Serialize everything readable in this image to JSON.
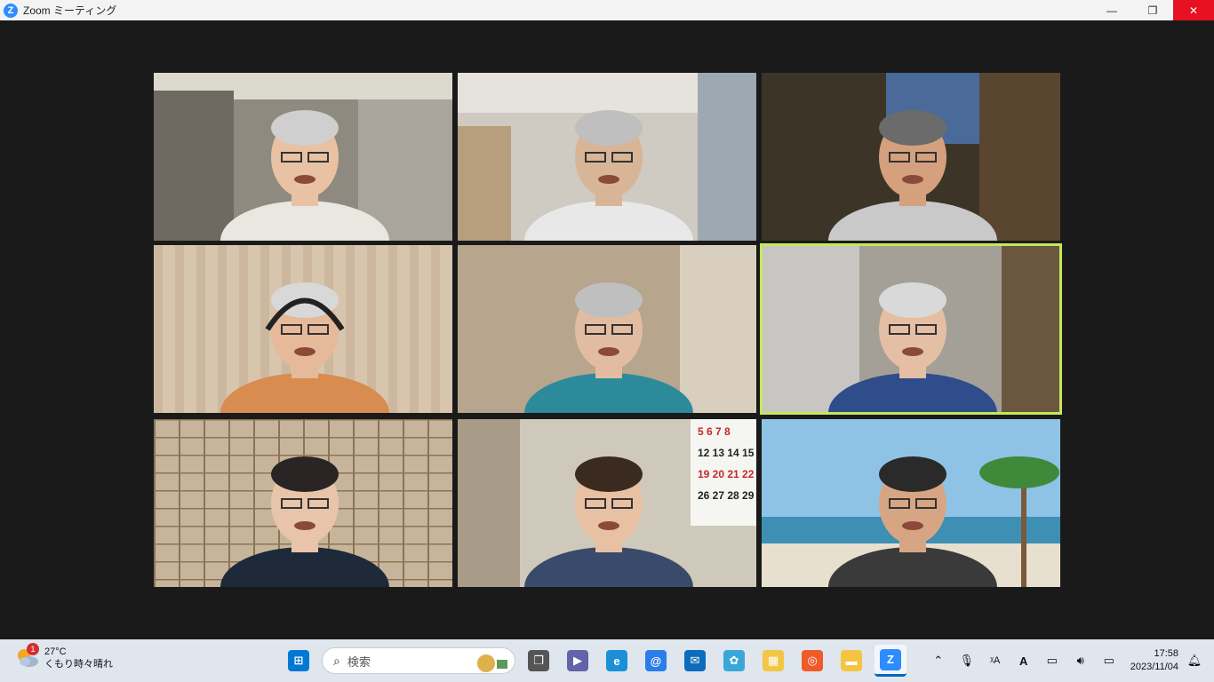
{
  "window": {
    "title": "Zoom ミーティング",
    "app_icon": "zoom-icon",
    "controls": [
      "minimize-icon",
      "restore-icon",
      "close-icon"
    ]
  },
  "meeting": {
    "participants": [
      {
        "id": 1,
        "bg": "#8f8a80",
        "shirt": "#e8e8e0",
        "skin": "#e8c2a3",
        "hair": "#cfcfcf",
        "scene": "outdoor-canal"
      },
      {
        "id": 2,
        "bg": "#cfcac2",
        "shirt": "#e8e8e8",
        "skin": "#d9b597",
        "hair": "#bfbfbf",
        "scene": "room-curtain"
      },
      {
        "id": 3,
        "bg": "#3d3428",
        "shirt": "#c9c9c9",
        "skin": "#d4a07e",
        "hair": "#6b6b6b",
        "scene": "study-bookshelf"
      },
      {
        "id": 4,
        "bg": "#d8c5ae",
        "shirt": "#d98c4f",
        "skin": "#e6b99a",
        "hair": "#d8d8d8",
        "scene": "curtain-headphones"
      },
      {
        "id": 5,
        "bg": "#b7a58e",
        "shirt": "#2d8a9b",
        "skin": "#e2bca1",
        "hair": "#bfbfbf",
        "scene": "blurred-room"
      },
      {
        "id": 6,
        "bg": "#a5a097",
        "shirt": "#2e4d8a",
        "skin": "#e4bfa4",
        "hair": "#d9d9d9",
        "scene": "room-shelf",
        "active_speaker": true
      },
      {
        "id": 7,
        "bg": "#c7b59b",
        "shirt": "#1e2a3a",
        "skin": "#e8c4aa",
        "hair": "#2b2424",
        "scene": "shoji-screen"
      },
      {
        "id": 8,
        "bg": "#cfc9bb",
        "shirt": "#3a4a6a",
        "skin": "#e8c0a2",
        "hair": "#3a2a20",
        "scene": "calendar-wall",
        "calendar": [
          "5 6 7 8",
          "12 13 14 15",
          "19 20 21 22",
          "26 27 28 29"
        ]
      },
      {
        "id": 9,
        "bg": "#8fc3e6",
        "shirt": "#3a3a3a",
        "skin": "#d6a684",
        "hair": "#2a2a2a",
        "scene": "beach-palm"
      }
    ]
  },
  "taskbar": {
    "weather": {
      "temp": "27°C",
      "desc": "くもり時々晴れ",
      "badge": "1",
      "icon": "cloud-sun-icon"
    },
    "search_placeholder": "検索",
    "apps": [
      {
        "name": "start",
        "icon": "windows-icon",
        "color": "#0078d4"
      },
      {
        "name": "task-view",
        "icon": "task-view-icon",
        "color": "#555555"
      },
      {
        "name": "video",
        "icon": "video-camera-icon",
        "color": "#6264a7"
      },
      {
        "name": "edge",
        "icon": "edge-icon",
        "color": "#1b8fd8"
      },
      {
        "name": "mail-at",
        "icon": "at-icon",
        "color": "#2b7de9"
      },
      {
        "name": "mail",
        "icon": "mail-icon",
        "color": "#0f6cbd"
      },
      {
        "name": "paint",
        "icon": "palette-icon",
        "color": "#3aa7d8"
      },
      {
        "name": "store",
        "icon": "store-icon",
        "color": "#f2c744"
      },
      {
        "name": "app-orange",
        "icon": "orange-app-icon",
        "color": "#f05a28"
      },
      {
        "name": "explorer",
        "icon": "folder-icon",
        "color": "#f5c542"
      },
      {
        "name": "zoom",
        "icon": "zoom-icon",
        "color": "#2d8cff",
        "active": true
      }
    ],
    "tray": [
      "chevron-up-icon",
      "microphone-icon",
      "ime-icon",
      "font-a-icon",
      "display-icon",
      "volume-icon",
      "battery-icon"
    ],
    "clock": {
      "time": "17:58",
      "date": "2023/11/04"
    },
    "notification_icon": "bell-icon"
  }
}
